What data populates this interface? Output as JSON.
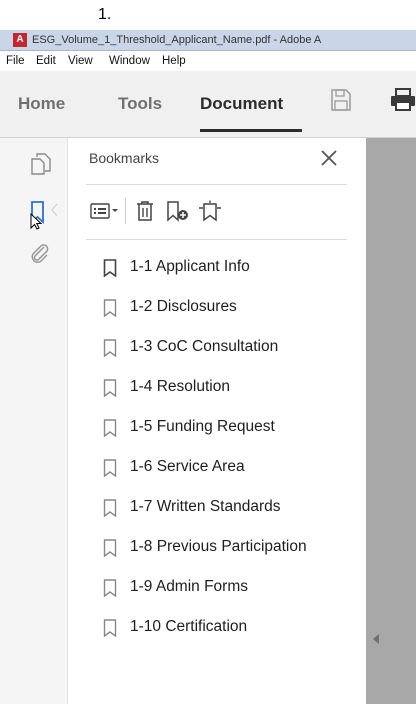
{
  "annotation": "1.",
  "window": {
    "title": "ESG_Volume_1_Threshold_Applicant_Name.pdf - Adobe A"
  },
  "menu": [
    "File",
    "Edit",
    "View",
    "Window",
    "Help"
  ],
  "tabs": [
    {
      "label": "Home",
      "active": false
    },
    {
      "label": "Tools",
      "active": false
    },
    {
      "label": "Document",
      "active": true
    }
  ],
  "toolbar_icons": [
    "save-icon",
    "print-icon"
  ],
  "left_rail": [
    "pages-icon",
    "bookmark-icon",
    "attachment-icon"
  ],
  "panel": {
    "title": "Bookmarks",
    "tools": [
      "options-menu-icon",
      "delete-bookmark-icon",
      "new-bookmark-icon",
      "expand-bookmark-icon"
    ]
  },
  "bookmarks": [
    "1-1 Applicant Info",
    "1-2 Disclosures",
    "1-3 CoC Consultation",
    "1-4 Resolution",
    "1-5 Funding Request",
    "1-6 Service Area",
    "1-7 Written Standards",
    "1-8 Previous Participation",
    "1-9 Admin Forms",
    "1-10 Certification"
  ],
  "colors": {
    "accent": "#2f6fd6",
    "toolbar_bg": "#f0f0f0",
    "viewer_bg": "#a8a8a8"
  }
}
